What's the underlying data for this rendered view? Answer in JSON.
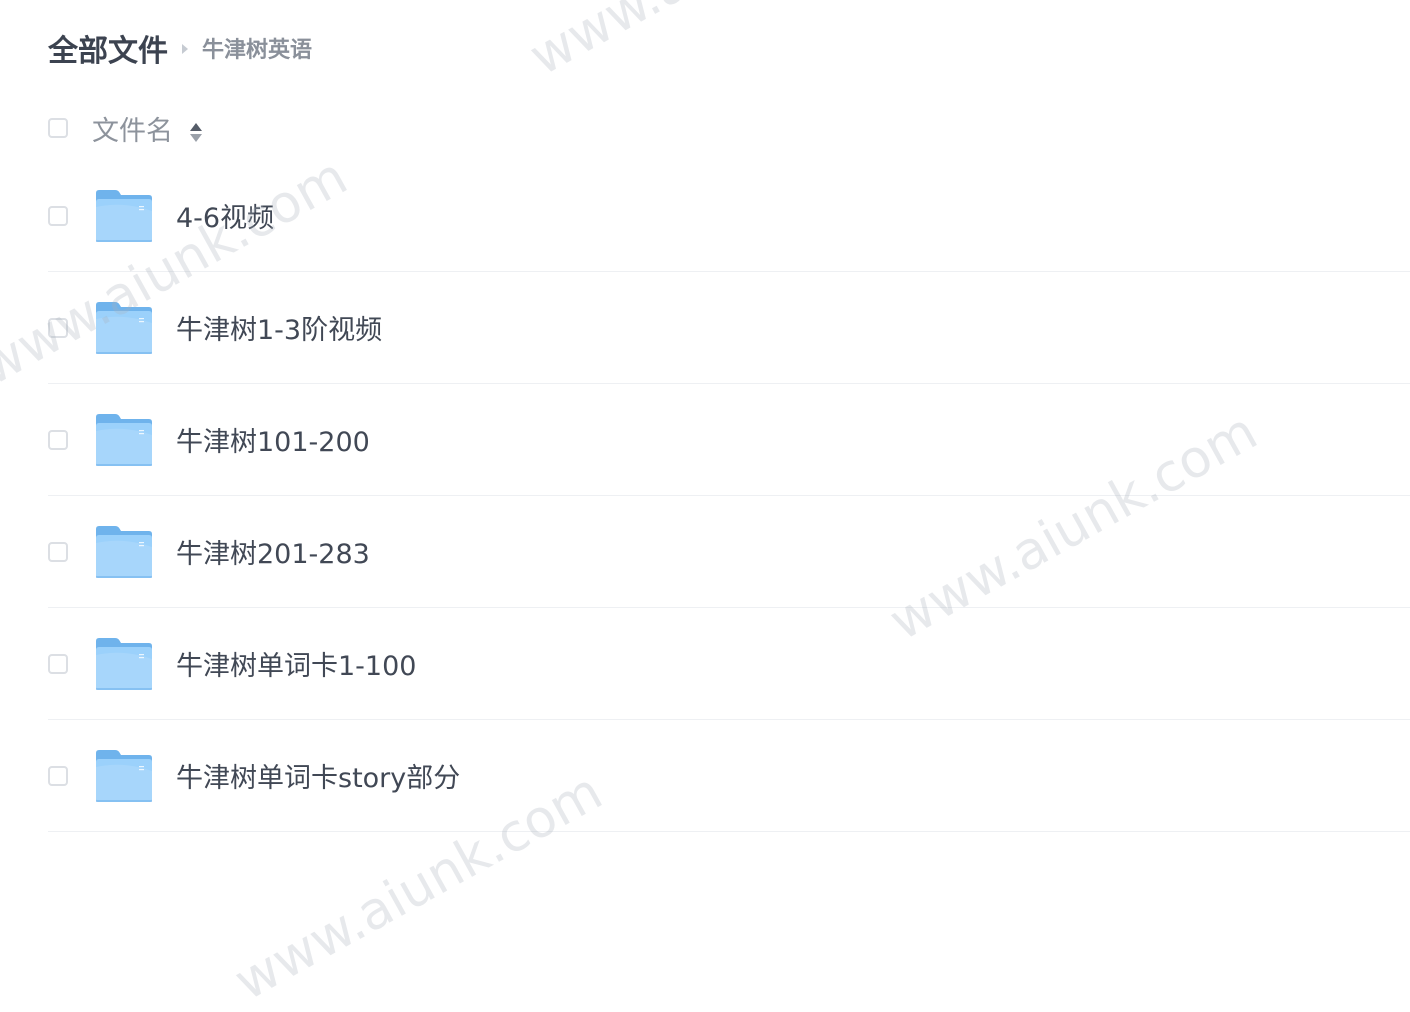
{
  "breadcrumb": {
    "root": "全部文件",
    "current": "牛津树英语"
  },
  "list_header": {
    "name_column": "文件名"
  },
  "files": [
    {
      "name": "4-6视频",
      "type": "folder-icon"
    },
    {
      "name": "牛津树1-3阶视频",
      "type": "folder-icon"
    },
    {
      "name": "牛津树101-200",
      "type": "folder-icon"
    },
    {
      "name": "牛津树201-283",
      "type": "folder-icon"
    },
    {
      "name": "牛津树单词卡1-100",
      "type": "folder-icon"
    },
    {
      "name": "牛津树单词卡story部分",
      "type": "folder-icon"
    }
  ],
  "watermark": "www.aiunk.com",
  "colors": {
    "folder_back": "#6fb3ec",
    "folder_front": "#9bd1fb",
    "text": "#414855",
    "muted": "#8d939c"
  }
}
